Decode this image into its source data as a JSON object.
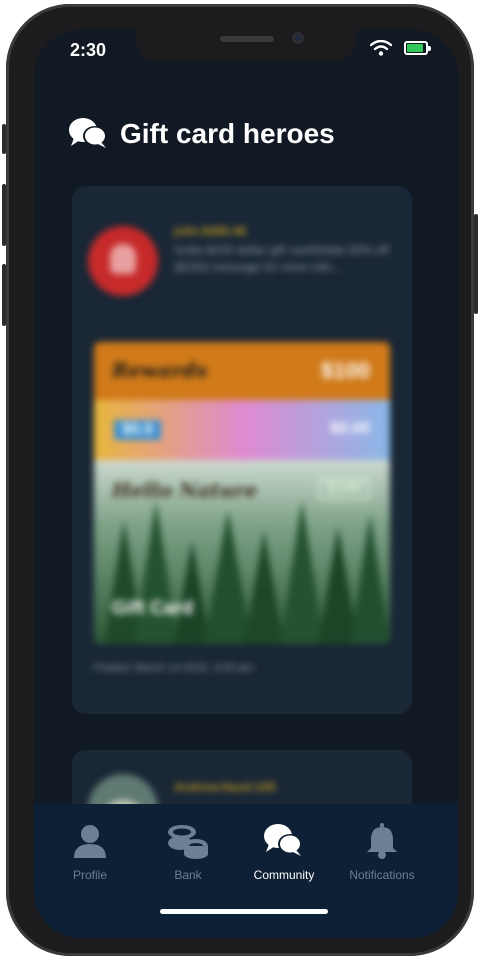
{
  "status": {
    "time": "2:30",
    "battery_level": 0.9,
    "battery_color": "#34c759"
  },
  "header": {
    "title": "Gift card heroes",
    "icon": "chat-bubbles-icon"
  },
  "posts": [
    {
      "username": "jolin.8d85.48",
      "text": "Gotta $100 dollar gift card/totale 50% off ($150) message for more info...",
      "gift_card": {
        "brand_logo": "Rewards",
        "price": "$100",
        "middle_label": "$0.0",
        "middle_price": "$0.00",
        "script_title": "Hello Nature",
        "lower_price": "$100",
        "caption": "Gift Card"
      },
      "timestamp": "Posted: March 14 2022, 3:00 pm"
    },
    {
      "username": "Andrew.Hazel.105",
      "text": ""
    }
  ],
  "tabs": [
    {
      "label": "Profile",
      "icon": "person-icon",
      "active": false
    },
    {
      "label": "Bank",
      "icon": "coins-icon",
      "active": false
    },
    {
      "label": "Community",
      "icon": "chat-bubbles-icon",
      "active": true
    },
    {
      "label": "Notifications",
      "icon": "bell-icon",
      "active": false
    }
  ]
}
